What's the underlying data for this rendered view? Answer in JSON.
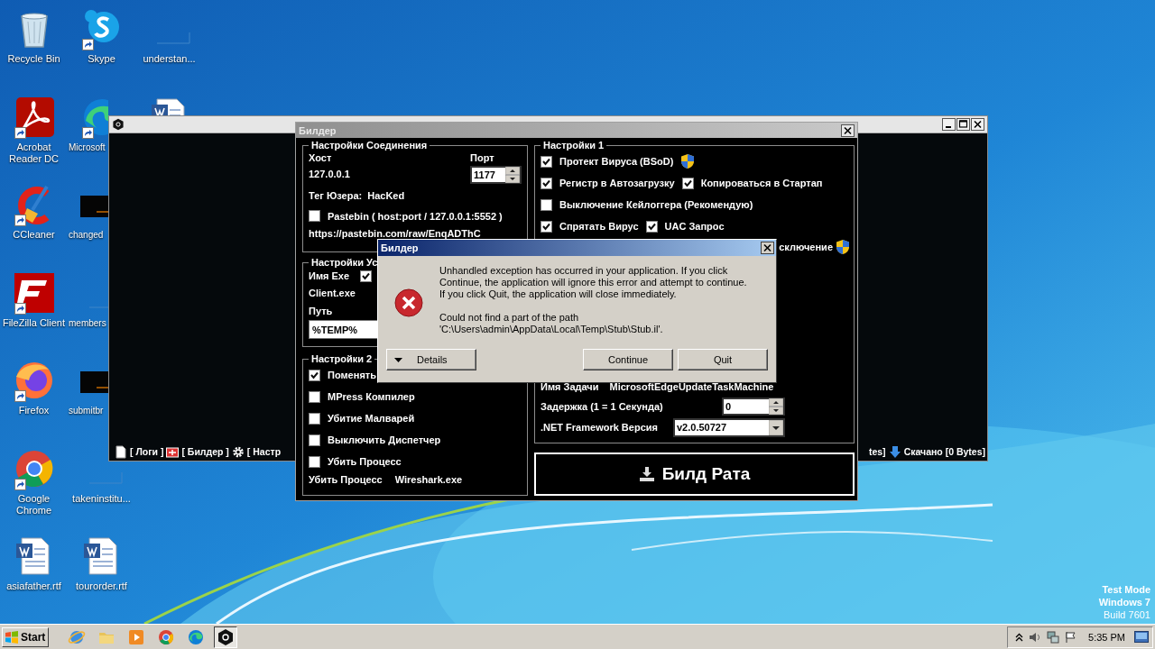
{
  "desktop": {
    "columns": [
      [
        {
          "label": "Recycle Bin",
          "kind": "recycle-bin",
          "shortcut": false,
          "cut_right": false,
          "cut_bottom": false
        },
        {
          "label": "Acrobat\nReader DC",
          "kind": "acrobat",
          "shortcut": true,
          "cut_right": false,
          "cut_bottom": false
        },
        {
          "label": "CCleaner",
          "kind": "ccleaner",
          "shortcut": true,
          "cut_right": false,
          "cut_bottom": false
        },
        {
          "label": "FileZilla Client",
          "kind": "filezilla",
          "shortcut": true,
          "cut_right": false,
          "cut_bottom": false
        },
        {
          "label": "Firefox",
          "kind": "firefox",
          "shortcut": true,
          "cut_right": false,
          "cut_bottom": false
        },
        {
          "label": "Google\nChrome",
          "kind": "chrome",
          "shortcut": true,
          "cut_right": false,
          "cut_bottom": false
        },
        {
          "label": "asiafather.rtf",
          "kind": "word-doc",
          "shortcut": false,
          "cut_right": false,
          "cut_bottom": false
        }
      ],
      [
        {
          "label": "Skype",
          "kind": "skype",
          "shortcut": true,
          "cut_right": false,
          "cut_bottom": false
        },
        {
          "label": "Microsoft",
          "kind": "edge",
          "shortcut": true,
          "cut_right": true,
          "cut_bottom": false
        },
        {
          "label": "changed",
          "kind": "black-image",
          "shortcut": false,
          "cut_right": true,
          "cut_bottom": false
        },
        {
          "label": "members",
          "kind": "blank",
          "shortcut": false,
          "cut_right": true,
          "cut_bottom": false
        },
        {
          "label": "submitbr",
          "kind": "black-image",
          "shortcut": false,
          "cut_right": true,
          "cut_bottom": false
        },
        {
          "label": "takeninstitu...",
          "kind": "blank",
          "shortcut": false,
          "cut_right": false,
          "cut_bottom": false
        },
        {
          "label": "tourorder.rtf",
          "kind": "word-doc",
          "shortcut": false,
          "cut_right": false,
          "cut_bottom": false
        }
      ],
      [
        {
          "label": "understan...",
          "kind": "blank",
          "shortcut": false,
          "cut_right": false,
          "cut_bottom": false
        },
        {
          "kind": "word-doc",
          "shortcut": false,
          "cut_right": false,
          "cut_bottom": true
        }
      ]
    ]
  },
  "os_notice": [
    "Test Mode",
    "Windows 7",
    "Build 7601"
  ],
  "main_window": {
    "status_left": [
      {
        "kind": "document",
        "label": "[ Логи ]"
      },
      {
        "kind": "builder",
        "label": "[ Билдер ]"
      },
      {
        "kind": "gear",
        "label": "[ Настр"
      }
    ],
    "status_right": [
      {
        "kind": "none",
        "label": "tes]"
      },
      {
        "kind": "download",
        "label": "Скачано [0 Bytes]"
      }
    ]
  },
  "builder": {
    "title": "Билдер",
    "connection": {
      "legend": "Настройки Соединения",
      "host_label": "Хост",
      "host": "127.0.0.1",
      "port_label": "Порт",
      "port": "1177",
      "tag_label": "Тег Юзера:",
      "tag": "HacKed",
      "pastebin": {
        "label": "Pastebin ( host:port / 127.0.0.1:5552  )",
        "checked": false
      },
      "pastebin_url": "https://pastebin.com/raw/EnqADThC"
    },
    "install": {
      "legend": "Настройки Ус",
      "exe_label": "Имя Exe",
      "exe_checked": true,
      "exe_name": "Client.exe",
      "path_label": "Путь",
      "path": "%TEMP%"
    },
    "settings2": {
      "legend": "Настройки 2",
      "options": [
        {
          "label": "Поменять",
          "checked": true
        },
        {
          "label": "MPress Компилер",
          "checked": false
        },
        {
          "label": "Убитие Малварей",
          "checked": false
        },
        {
          "label": "Выключить Диспетчер",
          "checked": false
        },
        {
          "label": "Убить Процесс",
          "checked": false
        }
      ],
      "kill_label": "Убить Процесс",
      "kill_value": "Wireshark.exe"
    },
    "settings1": {
      "legend": "Настройки 1",
      "rows": [
        [
          {
            "label": "Протект Вируса (BSoD)",
            "checked": true,
            "shield": true
          }
        ],
        [
          {
            "label": "Регистр в Автозагрузку",
            "checked": true,
            "shield": false
          },
          {
            "label": "Копироваться в Стартап",
            "checked": true,
            "shield": false
          }
        ],
        [
          {
            "label": "Выключение Кейлоггера (Рекомендую)",
            "checked": false,
            "shield": false
          }
        ],
        [
          {
            "label": "Спрятать Вирус",
            "checked": true,
            "shield": false
          },
          {
            "label": "UAC Запрос",
            "checked": true,
            "shield": false
          }
        ]
      ],
      "partial_label": "сключение",
      "partial_shield": true,
      "task_label": "Имя Задачи",
      "task": "MicrosoftEdgeUpdateTaskMachine",
      "delay_label": "Задержка (1 = 1 Секунда)",
      "delay": "0",
      "framework_label": ".NET Framework Версия",
      "framework": "v2.0.50727"
    },
    "build_button": "Билд Рата"
  },
  "dialog": {
    "title": "Билдер",
    "message": "Unhandled exception has occurred in your application. If you click Continue, the application will ignore this error and attempt to continue. If you click Quit, the application will close immediately.",
    "detail": "Could not find a part of the path\n'C:\\Users\\admin\\AppData\\Local\\Temp\\Stub\\Stub.il'.",
    "details_button": "Details",
    "continue_button": "Continue",
    "quit_button": "Quit"
  },
  "taskbar": {
    "start": "Start",
    "apps": [
      {
        "kind": "ie",
        "active": false
      },
      {
        "kind": "folder",
        "active": false
      },
      {
        "kind": "media",
        "active": false
      },
      {
        "kind": "chrome",
        "active": false
      },
      {
        "kind": "edge",
        "active": false
      },
      {
        "kind": "nt",
        "active": true
      }
    ],
    "clock": "5:35 PM"
  }
}
